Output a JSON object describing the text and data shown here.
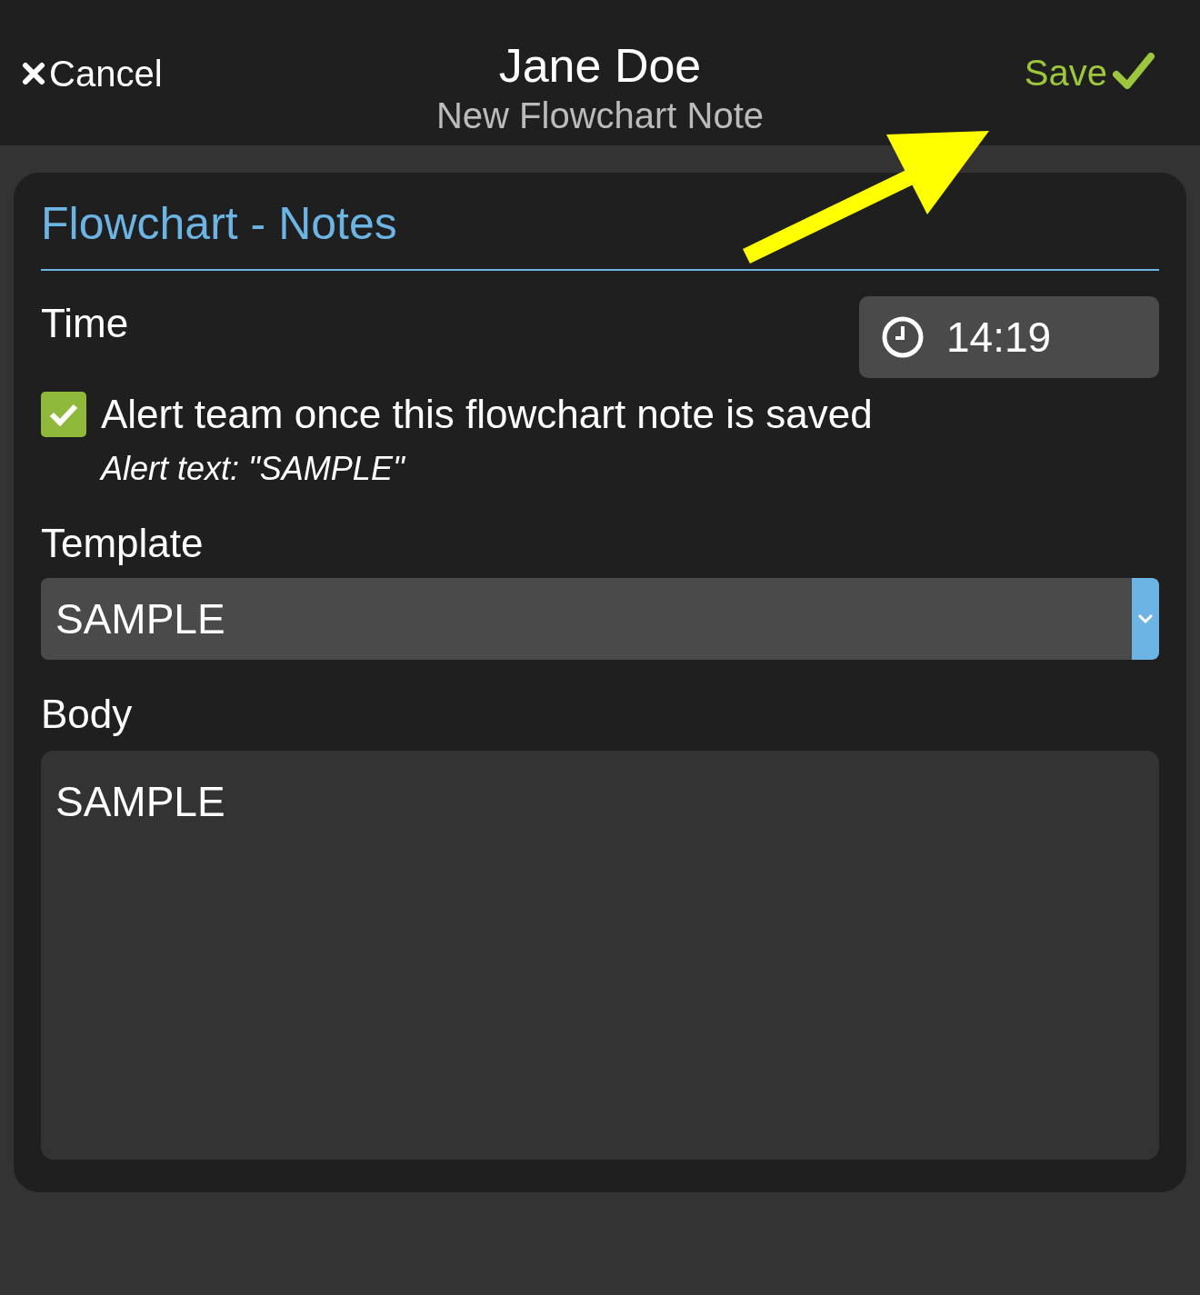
{
  "header": {
    "cancel": "Cancel",
    "title": "Jane Doe",
    "subtitle": "New Flowchart Note",
    "save": "Save"
  },
  "section_title": "Flowchart - Notes",
  "time": {
    "label": "Time",
    "value": "14:19"
  },
  "alert": {
    "checked": true,
    "label": "Alert team once this flowchart note is saved",
    "note": "Alert text: \"SAMPLE\""
  },
  "template": {
    "label": "Template",
    "value": "SAMPLE"
  },
  "body": {
    "label": "Body",
    "value": "SAMPLE"
  }
}
